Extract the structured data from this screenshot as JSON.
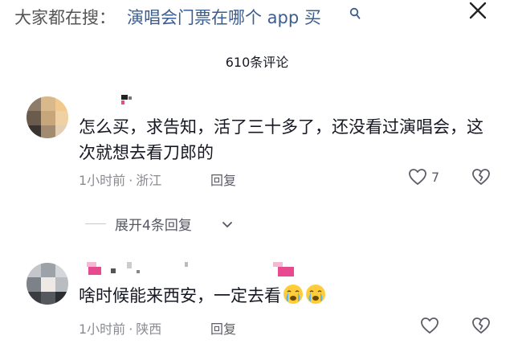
{
  "search": {
    "prefix": "大家都在搜：",
    "query": "演唱会门票在哪个 app 买"
  },
  "header": {
    "comment_count": "610条评论"
  },
  "comments": [
    {
      "text": "怎么买，求告知，活了三十多了，还没看过演唱会，这次就想去看刀郎的",
      "time": "1小时前",
      "location": "浙江",
      "reply_label": "回复",
      "like_count": "7"
    },
    {
      "text": "啥时候能来西安，一定去看",
      "time": "1小时前",
      "location": "陕西",
      "reply_label": "回复",
      "like_count": ""
    }
  ],
  "expand_replies_label": "展开4条回复",
  "meta_separator": "·",
  "colors": {
    "link": "#3b5d8f",
    "pink_username": "#e84a8f",
    "muted": "#8a8b91"
  },
  "icons": [
    "search-icon",
    "close-icon",
    "heart-outline-icon",
    "broken-heart-icon",
    "chevron-down-icon",
    "crying-face-emoji"
  ]
}
